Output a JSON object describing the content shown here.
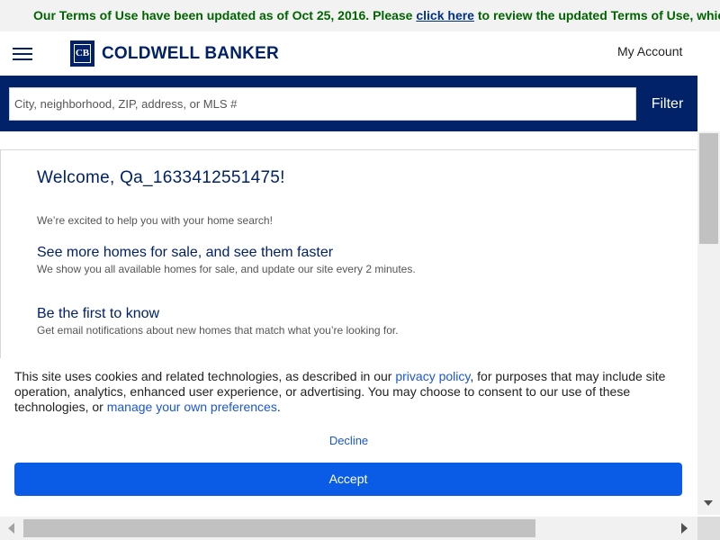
{
  "terms_banner": {
    "text_before": "Our Terms of Use have been updated as of Oct 25, 2016. Please ",
    "link": "click here",
    "text_after": " to review the updated Terms of Use, which ar"
  },
  "header": {
    "logo_mark": "CB",
    "logo_text": "COLDWELL BANKER",
    "my_account": "My Account"
  },
  "search": {
    "placeholder": "City, neighborhood, ZIP, address, or MLS #",
    "value": "",
    "filter_label": "Filter"
  },
  "welcome": {
    "title": "Welcome, Qa_1633412551475!",
    "intro": "We’re excited to help you with your home search!",
    "features": [
      {
        "title": "See more homes for sale, and see them faster",
        "description": "We show you all available homes for sale, and update our site every 2 minutes."
      },
      {
        "title": "Be the first to know",
        "description": "Get email notifications about new homes that match what you’re looking for."
      }
    ]
  },
  "cookie_banner": {
    "text_1": "This site uses cookies and related technologies, as described in our ",
    "link_privacy": "privacy policy",
    "text_2": ", for purposes that may include site operation, analytics, enhanced user experience, or advertising. You may choose to consent to our use of these technologies, or ",
    "link_preferences": "manage your own preferences",
    "text_3": ".",
    "decline_label": "Decline",
    "accept_label": "Accept"
  },
  "colors": {
    "brand_navy": "#012169",
    "accept_blue": "#0a5ce6",
    "link_blue": "#1a56db",
    "terms_green": "#006400"
  }
}
